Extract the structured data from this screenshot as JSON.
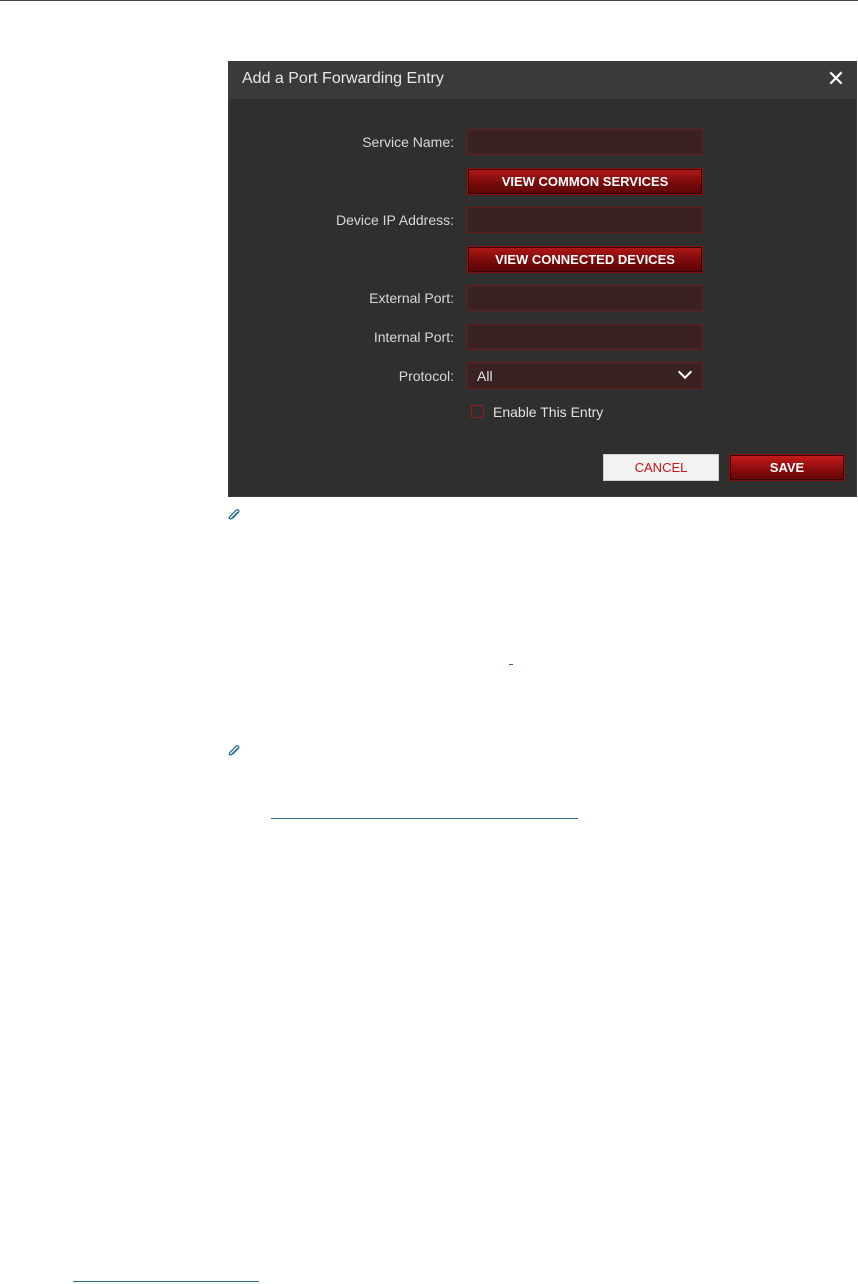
{
  "dialog": {
    "title": "Add a Port Forwarding Entry",
    "close_glyph": "✕",
    "fields": {
      "service_name": {
        "label": "Service Name:",
        "value": ""
      },
      "device_ip": {
        "label": "Device IP Address:",
        "value": ""
      },
      "external_port": {
        "label": "External Port:",
        "value": ""
      },
      "internal_port": {
        "label": "Internal Port:",
        "value": ""
      },
      "protocol": {
        "label": "Protocol:",
        "value": "All"
      }
    },
    "buttons": {
      "view_common_services": "VIEW COMMON SERVICES",
      "view_connected_devices": "VIEW CONNECTED DEVICES",
      "cancel": "CANCEL",
      "save": "SAVE"
    },
    "enable_entry": {
      "label": "Enable This Entry",
      "checked": false
    }
  },
  "icons": {
    "note_icon_1": "paperclip-icon",
    "note_icon_2": "paperclip-icon"
  },
  "colors": {
    "dialog_bg": "#2f2f2f",
    "header_bg": "#3a3a3a",
    "accent_red": "#b21818",
    "link": "#2a6f87"
  }
}
